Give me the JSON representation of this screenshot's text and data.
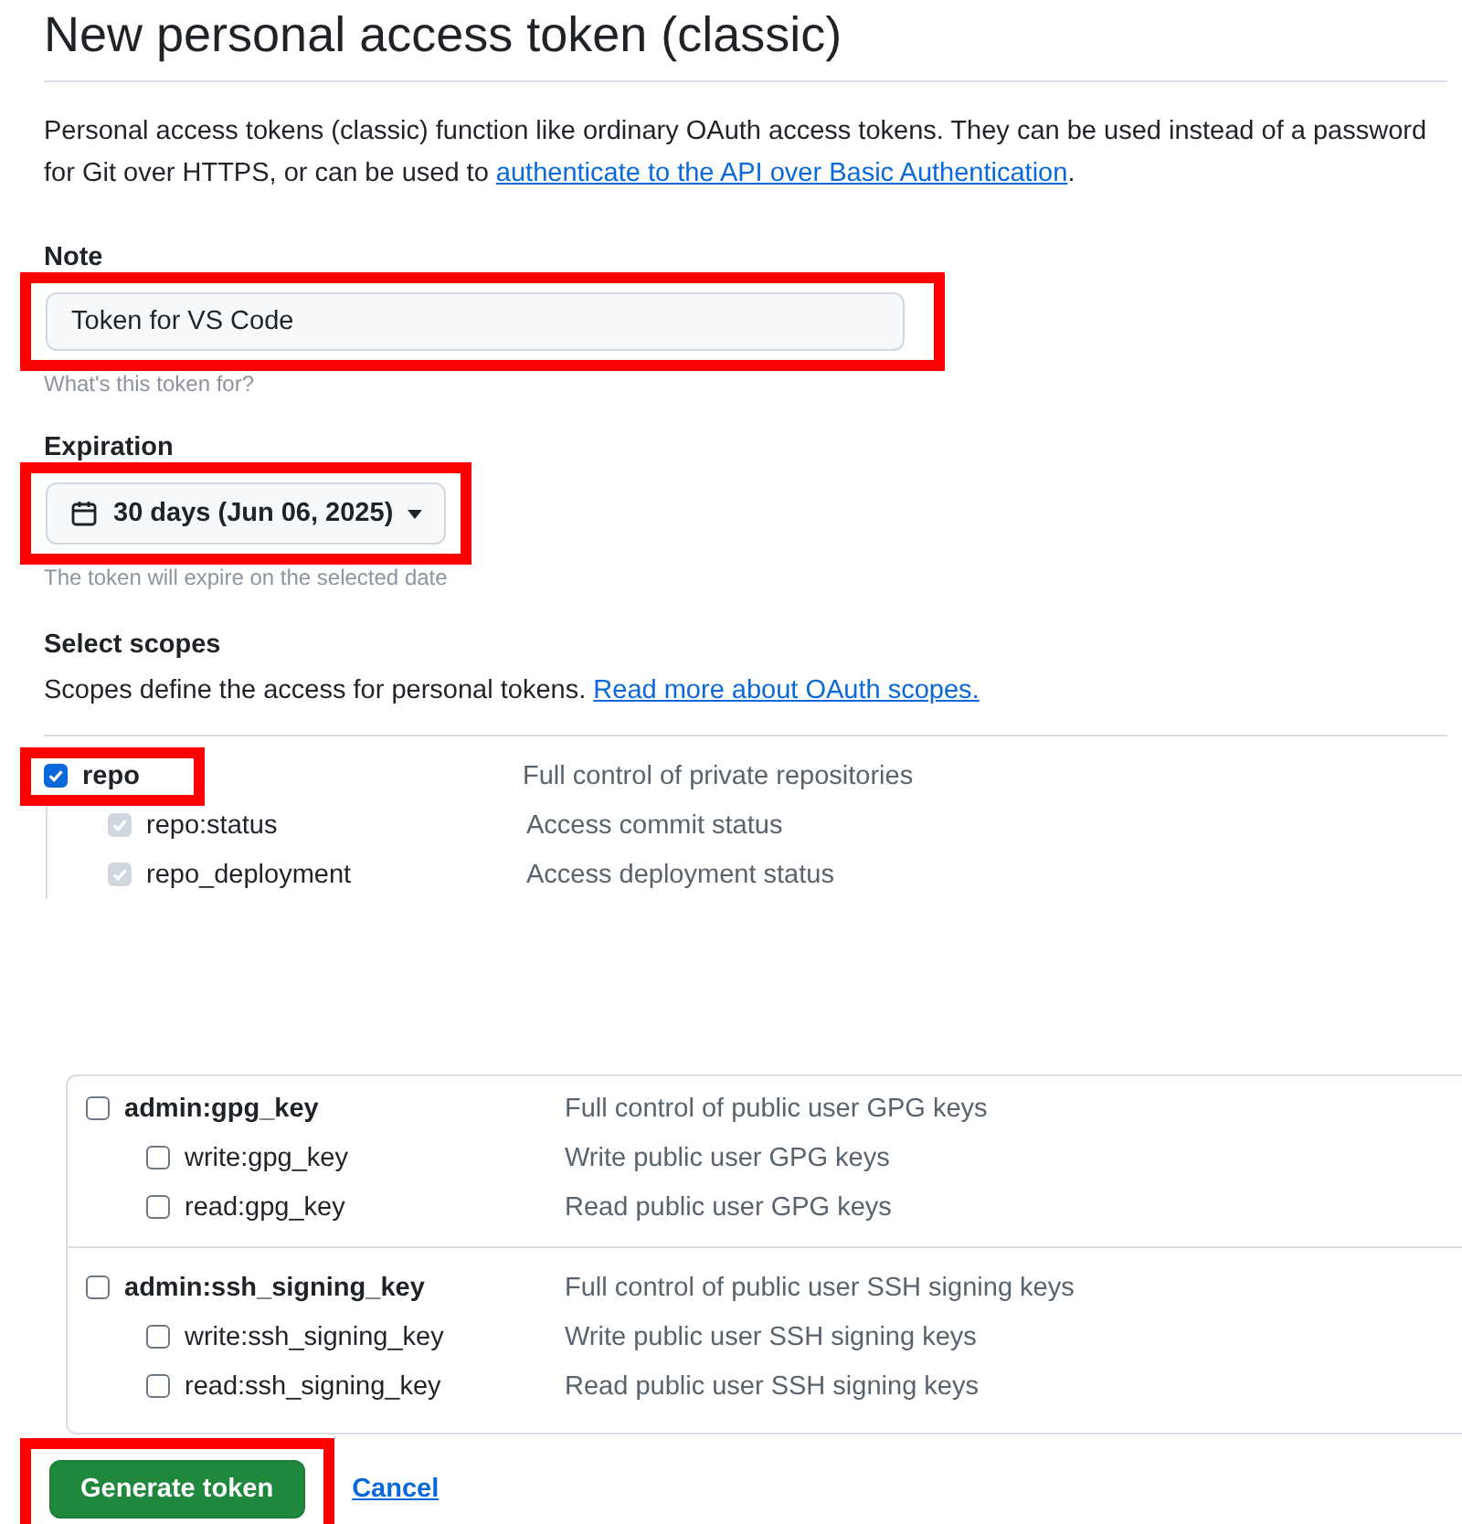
{
  "page_title": "New personal access token (classic)",
  "intro": {
    "text": "Personal access tokens (classic) function like ordinary OAuth access tokens. They can be used instead of a password for Git over HTTPS, or can be used to",
    "link": "authenticate to the API over Basic Authentication",
    "end": "."
  },
  "note": {
    "label": "Note",
    "value": "Token for VS Code",
    "hint": "What's this token for?",
    "highlighted": true
  },
  "expiration": {
    "label": "Expiration",
    "value": "30 days (Jun 06, 2025)",
    "hint": "The token will expire on the selected date",
    "highlighted": true
  },
  "scopes": {
    "title": "Select scopes",
    "description": "Scopes define the access for personal tokens.",
    "link": "Read more about OAuth scopes."
  },
  "scope_groups_top": [
    {
      "name": "repo",
      "description": "Full control of private repositories",
      "checked": true,
      "highlighted": true,
      "children": [
        {
          "name": "repo:status",
          "description": "Access commit status",
          "checked": true,
          "disabled": true
        },
        {
          "name": "repo_deployment",
          "description": "Access deployment status",
          "checked": true,
          "disabled": true
        }
      ]
    }
  ],
  "scope_groups_bottom": [
    {
      "name": "admin:gpg_key",
      "description": "Full control of public user GPG keys",
      "checked": false,
      "highlighted": false,
      "children": [
        {
          "name": "write:gpg_key",
          "description": "Write public user GPG keys",
          "checked": false,
          "disabled": false
        },
        {
          "name": "read:gpg_key",
          "description": "Read public user GPG keys",
          "checked": false,
          "disabled": false
        }
      ]
    },
    {
      "name": "admin:ssh_signing_key",
      "description": "Full control of public user SSH signing keys",
      "checked": false,
      "highlighted": false,
      "children": [
        {
          "name": "write:ssh_signing_key",
          "description": "Write public user SSH signing keys",
          "checked": false,
          "disabled": false
        },
        {
          "name": "read:ssh_signing_key",
          "description": "Read public user SSH signing keys",
          "checked": false,
          "disabled": false
        }
      ]
    }
  ],
  "buttons": {
    "generate": {
      "label": "Generate token",
      "highlighted": true
    },
    "cancel": {
      "label": "Cancel"
    }
  }
}
